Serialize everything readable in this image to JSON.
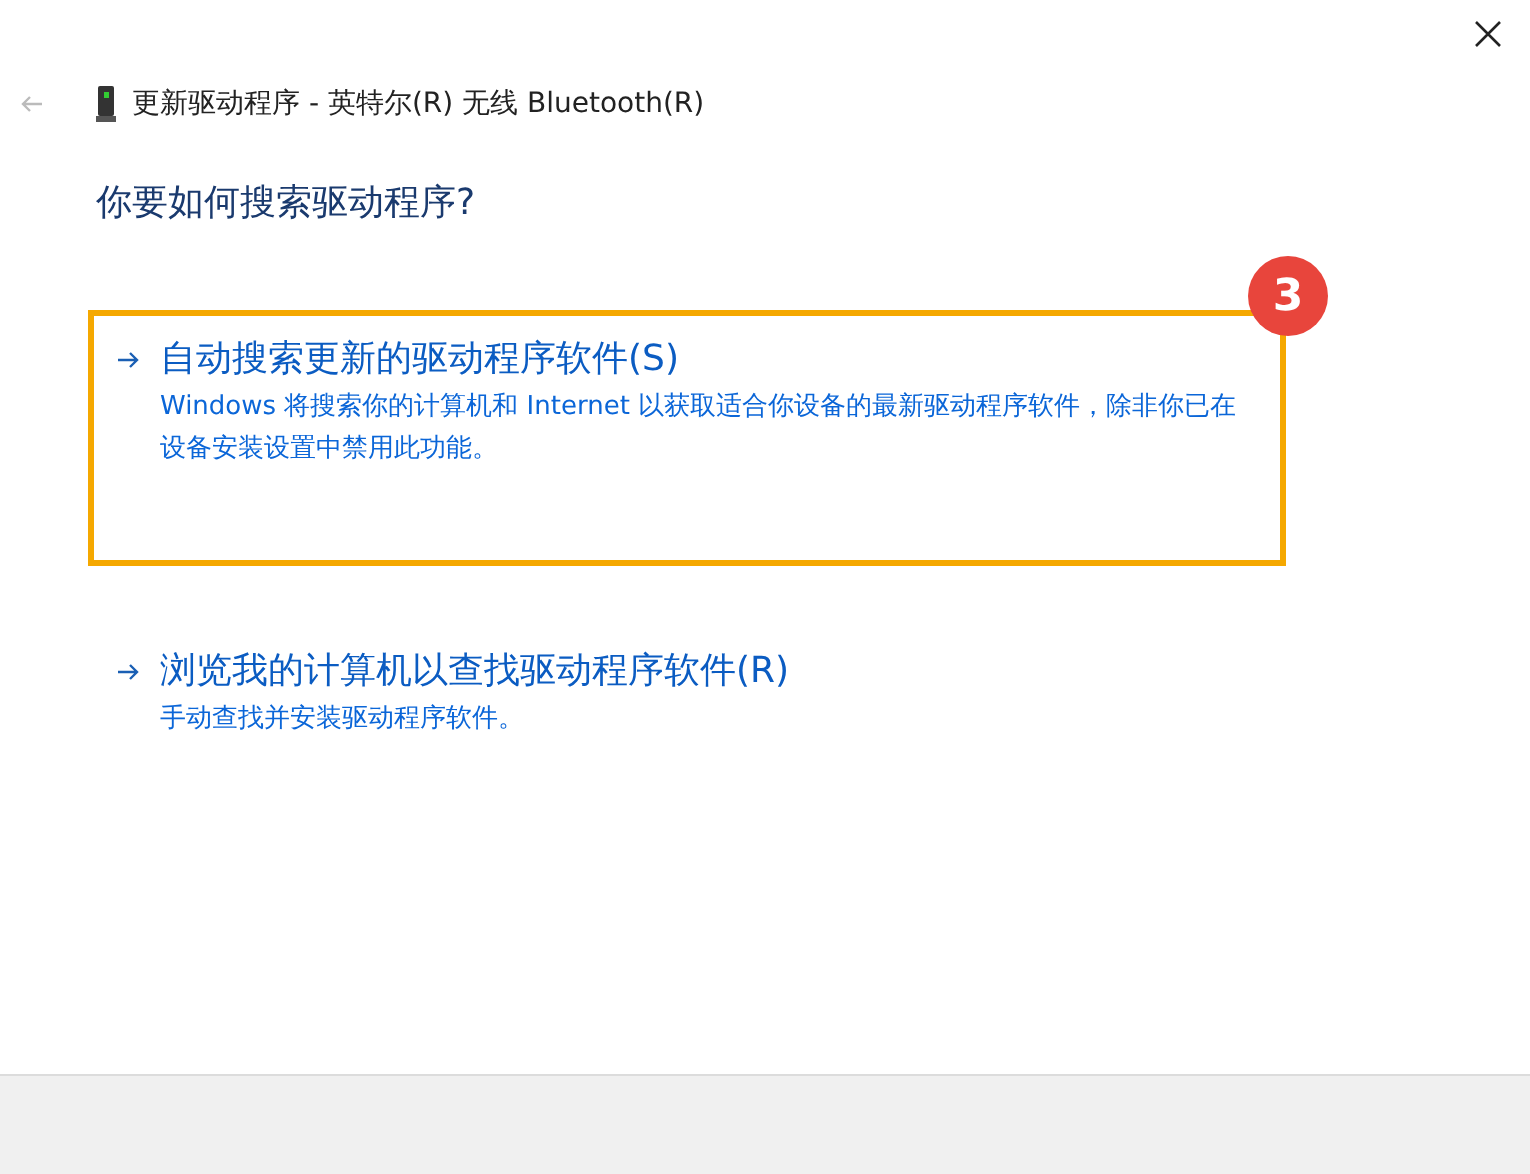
{
  "window": {
    "title": "更新驱动程序 - 英特尔(R) 无线 Bluetooth(R)"
  },
  "heading": "你要如何搜索驱动程序?",
  "options": [
    {
      "title": "自动搜索更新的驱动程序软件(S)",
      "description": "Windows 将搜索你的计算机和 Internet 以获取适合你设备的最新驱动程序软件，除非你已在设备安装设置中禁用此功能。",
      "highlighted": true
    },
    {
      "title": "浏览我的计算机以查找驱动程序软件(R)",
      "description": "手动查找并安装驱动程序软件。",
      "highlighted": false
    }
  ],
  "step_badge": "3"
}
